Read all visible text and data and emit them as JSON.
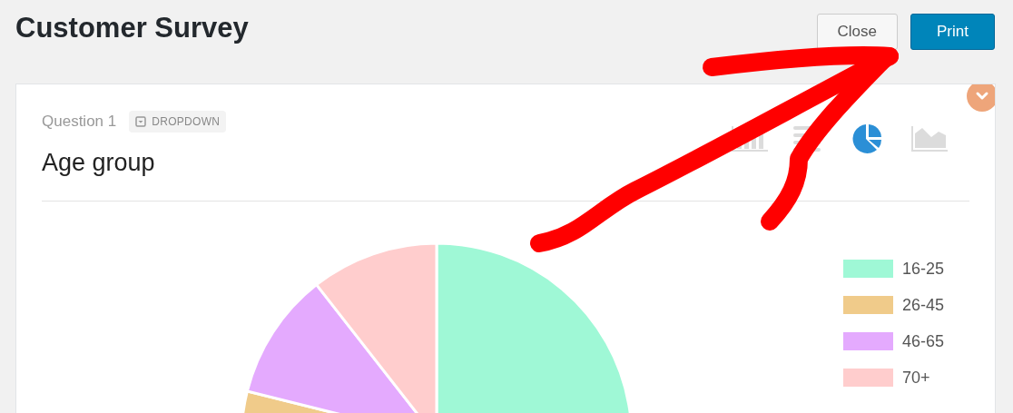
{
  "page": {
    "title": "Customer Survey"
  },
  "buttons": [
    {
      "label": "Close",
      "kind": "secondary"
    },
    {
      "label": "Print",
      "kind": "primary"
    }
  ],
  "question": {
    "number": "Question 1",
    "type_badge": "DROPDOWN",
    "title": "Age group"
  },
  "chart_types": [
    {
      "kind": "bar",
      "selected": false
    },
    {
      "kind": "list",
      "selected": false
    },
    {
      "kind": "pie",
      "selected": true
    },
    {
      "kind": "area",
      "selected": false
    }
  ],
  "legend": [
    {
      "label": "16-25",
      "color": "#9ff8d6"
    },
    {
      "label": "26-45",
      "color": "#f0cb8a"
    },
    {
      "label": "46-65",
      "color": "#e4aafe"
    },
    {
      "label": "70+",
      "color": "#ffcdcd"
    }
  ]
}
